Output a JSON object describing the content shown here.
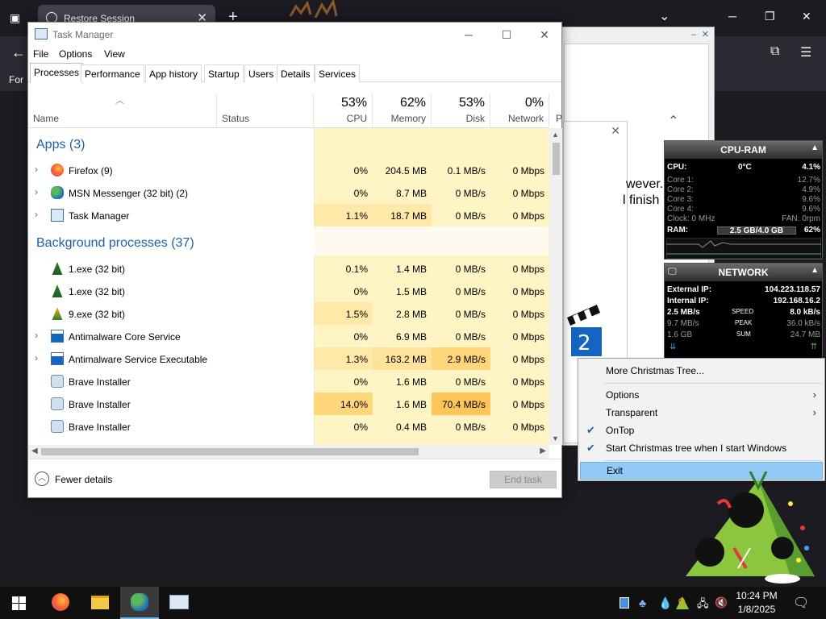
{
  "browser": {
    "tab_title": "Restore Session",
    "tab_close": "✕",
    "new_tab": "+",
    "back": "←",
    "menu": "☰",
    "for_label": "For",
    "win_minimize": "─",
    "win_maximize": "❐",
    "win_close": "✕",
    "chevron": "⌄"
  },
  "behind": {
    "text1": "wever.",
    "text2": "l finish"
  },
  "task_manager": {
    "title": "Task Manager",
    "menu": [
      "File",
      "Options",
      "View"
    ],
    "tabs": [
      "Processes",
      "Performance",
      "App history",
      "Startup",
      "Users",
      "Details",
      "Services"
    ],
    "active_tab": "Processes",
    "columns": {
      "name": "Name",
      "status": "Status",
      "cpu": {
        "pct": "53%",
        "label": "CPU"
      },
      "memory": {
        "pct": "62%",
        "label": "Memory"
      },
      "disk": {
        "pct": "53%",
        "label": "Disk"
      },
      "network": {
        "pct": "0%",
        "label": "Network"
      },
      "more": "P"
    },
    "groups": {
      "apps": "Apps (3)",
      "background": "Background processes (37)"
    },
    "apps": [
      {
        "name": "Firefox (9)",
        "cpu": "0%",
        "memory": "204.5 MB",
        "disk": "0.1 MB/s",
        "network": "0 Mbps",
        "icon": "firefox-icon"
      },
      {
        "name": "MSN Messenger (32 bit) (2)",
        "cpu": "0%",
        "memory": "8.7 MB",
        "disk": "0 MB/s",
        "network": "0 Mbps",
        "icon": "msn-icon"
      },
      {
        "name": "Task Manager",
        "cpu": "1.1%",
        "memory": "18.7 MB",
        "disk": "0 MB/s",
        "network": "0 Mbps",
        "icon": "task-manager-icon"
      }
    ],
    "background": [
      {
        "name": "1.exe (32 bit)",
        "cpu": "0.1%",
        "memory": "1.4 MB",
        "disk": "0 MB/s",
        "network": "0 Mbps",
        "icon": "tree-exe-icon"
      },
      {
        "name": "1.exe (32 bit)",
        "cpu": "0%",
        "memory": "1.5 MB",
        "disk": "0 MB/s",
        "network": "0 Mbps",
        "icon": "tree-exe-icon"
      },
      {
        "name": "9.exe (32 bit)",
        "cpu": "1.5%",
        "memory": "2.8 MB",
        "disk": "0 MB/s",
        "network": "0 Mbps",
        "icon": "tree-exe-icon"
      },
      {
        "name": "Antimalware Core Service",
        "cpu": "0%",
        "memory": "6.9 MB",
        "disk": "0 MB/s",
        "network": "0 Mbps",
        "icon": "service-icon"
      },
      {
        "name": "Antimalware Service Executable",
        "cpu": "1.3%",
        "memory": "163.2 MB",
        "disk": "2.9 MB/s",
        "network": "0 Mbps",
        "icon": "service-icon"
      },
      {
        "name": "Brave Installer",
        "cpu": "0%",
        "memory": "1.6 MB",
        "disk": "0 MB/s",
        "network": "0 Mbps",
        "icon": "installer-icon"
      },
      {
        "name": "Brave Installer",
        "cpu": "14.0%",
        "memory": "1.6 MB",
        "disk": "70.4 MB/s",
        "network": "0 Mbps",
        "icon": "installer-icon"
      },
      {
        "name": "Brave Installer",
        "cpu": "0%",
        "memory": "0.4 MB",
        "disk": "0 MB/s",
        "network": "0 Mbps",
        "icon": "installer-icon"
      }
    ],
    "fewer_details": "Fewer details",
    "end_task": "End task"
  },
  "cpu_ram": {
    "title": "CPU-RAM",
    "cpu_label": "CPU:",
    "cpu_temp": "0°C",
    "cpu_value": "4.1%",
    "cores": [
      {
        "label": "Core 1:",
        "value": "12.7%"
      },
      {
        "label": "Core 2:",
        "value": "4.9%"
      },
      {
        "label": "Core 3:",
        "value": "9.6%"
      },
      {
        "label": "Core 4:",
        "value": "9.6%"
      }
    ],
    "clock_label": "Clock: 0 MHz",
    "fan_label": "FAN: 0rpm",
    "ram_label": "RAM:",
    "ram_value": "2.5 GB/4.0 GB",
    "ram_pct": "62%"
  },
  "network": {
    "title": "NETWORK",
    "external_label": "External IP:",
    "external_ip": "104.223.118.57",
    "internal_label": "Internal IP:",
    "internal_ip": "192.168.16.2",
    "speed_left": "2.5 MB/s",
    "speed_label": "SPEED",
    "speed_right": "8.0 kB/s",
    "peak_left": "9.7 MB/s",
    "peak_label": "PEAK",
    "peak_right": "36.0 kB/s",
    "sum_left": "1.6 GB",
    "sum_label": "SUM",
    "sum_right": "24.7 MB"
  },
  "context_menu": {
    "items": [
      {
        "label": "More Christmas Tree...",
        "checked": false,
        "submenu": false
      },
      {
        "label": "Options",
        "checked": false,
        "submenu": true
      },
      {
        "label": "Transparent",
        "checked": false,
        "submenu": true
      },
      {
        "label": "OnTop",
        "checked": true,
        "submenu": false
      },
      {
        "label": "Start Christmas tree when I start Windows",
        "checked": true,
        "submenu": false
      },
      {
        "label": "Exit",
        "checked": false,
        "submenu": false,
        "highlighted": true
      }
    ]
  },
  "taskbar": {
    "time": "10:24 PM",
    "date": "1/8/2025"
  },
  "colors": {
    "heat_light": "#fff4c4",
    "heat_mid": "#ffe9a8",
    "heat_strong": "#ffd67a",
    "link_blue": "#1e5fa8",
    "menu_highlight": "#91c9f7"
  }
}
